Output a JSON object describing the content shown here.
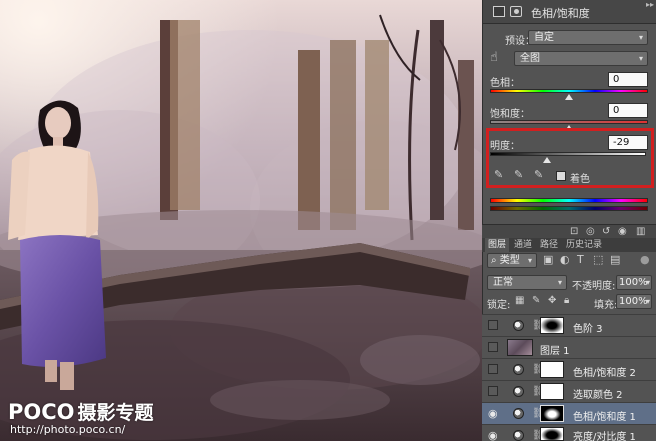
{
  "properties_panel": {
    "title": "色相/饱和度",
    "collapse_label": "▸▸",
    "preset_label": "预设：",
    "preset_value": "自定",
    "channel_value": "全图",
    "hue_label": "色相：",
    "hue_value": "0",
    "saturation_label": "饱和度：",
    "saturation_value": "0",
    "lightness_label": "明度：",
    "lightness_value": "-29",
    "colorize_label": "着色",
    "colorize_checked": false
  },
  "layers_panel": {
    "tabs": [
      {
        "label": "图层",
        "active": true
      },
      {
        "label": "通道",
        "active": false
      },
      {
        "label": "路径",
        "active": false
      },
      {
        "label": "历史记录",
        "active": false
      }
    ],
    "filter_kind": "类型",
    "blend_mode": "正常",
    "opacity_label": "不透明度:",
    "opacity_value": "100%",
    "lock_label": "锁定:",
    "fill_label": "填充:",
    "fill_value": "100%",
    "layers": [
      {
        "name": "色阶 3",
        "visible": false,
        "type": "adjustment",
        "selected": false
      },
      {
        "name": "图层 1",
        "visible": false,
        "type": "pixel",
        "selected": false
      },
      {
        "name": "色相/饱和度 2",
        "visible": false,
        "type": "adjustment",
        "selected": false
      },
      {
        "name": "选取颜色 2",
        "visible": false,
        "type": "adjustment",
        "selected": false
      },
      {
        "name": "色相/饱和度 1",
        "visible": true,
        "type": "adjustment",
        "selected": true
      },
      {
        "name": "亮度/对比度 1",
        "visible": true,
        "type": "adjustment",
        "selected": false
      }
    ]
  },
  "watermark": {
    "logo_text": "POCO",
    "logo_cn": "摄影专题",
    "url": "http://photo.poco.cn/"
  },
  "colors": {
    "panel_bg": "#535353",
    "highlight_box": "#d21f1f",
    "selected_layer": "#5f6f88"
  }
}
